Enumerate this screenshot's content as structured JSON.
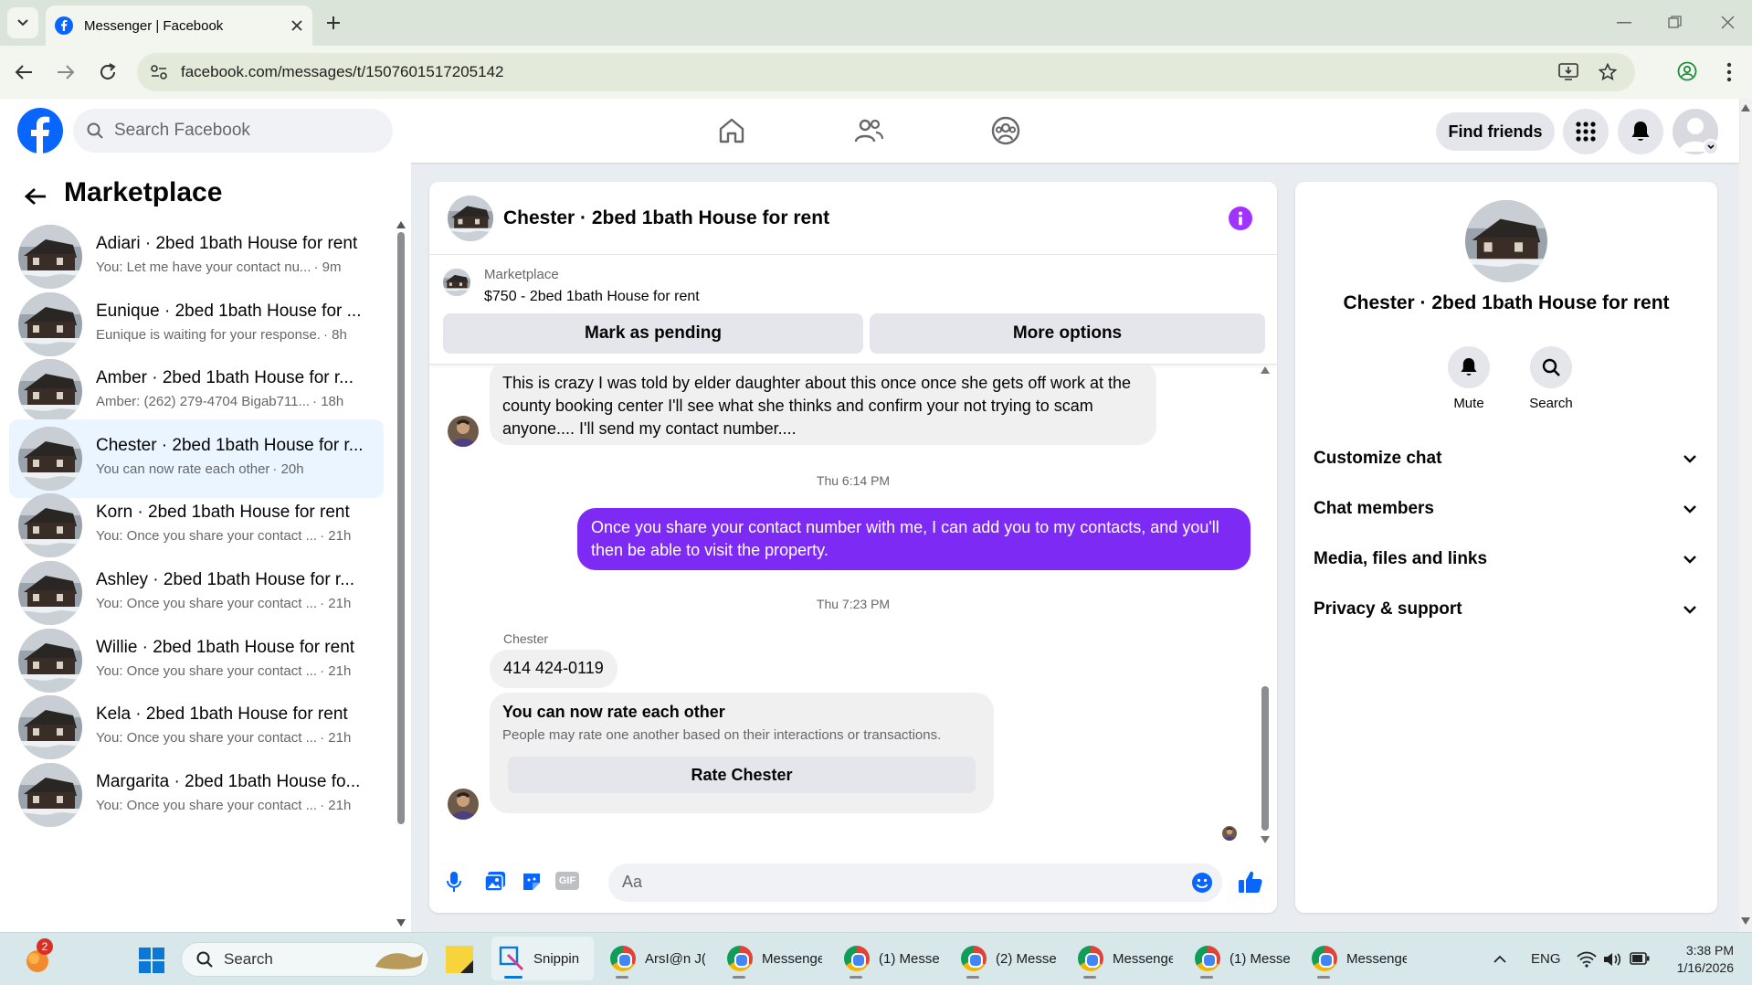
{
  "browser": {
    "tab_title": "Messenger | Facebook",
    "url": "facebook.com/messages/t/1507601517205142"
  },
  "header": {
    "search_placeholder": "Search Facebook",
    "find_friends": "Find friends"
  },
  "sidebar": {
    "title": "Marketplace",
    "conversations": [
      {
        "name": "Adiari · 2bed 1bath House for rent",
        "snippet": "You: Let me have your contact nu...",
        "time": "· 9m"
      },
      {
        "name": "Eunique · 2bed 1bath House for ...",
        "snippet": "Eunique is waiting for your response.",
        "time": "· 8h"
      },
      {
        "name": "Amber · 2bed 1bath House for r...",
        "snippet": "Amber: (262) 279-4704 Bigab711...",
        "time": "· 18h"
      },
      {
        "name": "Chester · 2bed 1bath House for r...",
        "snippet": "You can now rate each other",
        "time": "· 20h"
      },
      {
        "name": "Korn · 2bed 1bath House for rent",
        "snippet": "You: Once you share your contact ...",
        "time": "· 21h"
      },
      {
        "name": "Ashley · 2bed 1bath House for r...",
        "snippet": "You: Once you share your contact ...",
        "time": "· 21h"
      },
      {
        "name": "Willie · 2bed 1bath House for rent",
        "snippet": "You: Once you share your contact ...",
        "time": "· 21h"
      },
      {
        "name": "Kela · 2bed 1bath House for rent",
        "snippet": "You: Once you share your contact ...",
        "time": "· 21h"
      },
      {
        "name": "Margarita · 2bed 1bath House fo...",
        "snippet": "You: Once you share your contact ...",
        "time": "· 21h"
      }
    ]
  },
  "chat": {
    "title": "Chester · 2bed 1bath House for rent",
    "listing_source": "Marketplace",
    "listing_title": "$750 - 2bed 1bath House for rent",
    "mark_pending": "Mark as pending",
    "more_options": "More options",
    "msg1": "This is crazy I was told by elder daughter  about this once once she gets off work at the county booking center I'll see what she thinks and confirm your not trying to scam anyone.... I'll send my contact number....",
    "time1": "Thu 6:14 PM",
    "msg2": "Once you share your contact number with me, I can add you to my contacts, and you'll then be able to visit the property.",
    "time2": "Thu 7:23 PM",
    "sender": "Chester",
    "msg3": "414 424-0119",
    "rate_title": "You can now rate each other",
    "rate_sub": "People may rate one another based on their interactions or transactions.",
    "rate_button": "Rate Chester",
    "composer_placeholder": "Aa"
  },
  "details": {
    "title": "Chester · 2bed 1bath House for rent",
    "mute": "Mute",
    "search": "Search",
    "sections": [
      "Customize chat",
      "Chat members",
      "Media, files and links",
      "Privacy & support"
    ]
  },
  "taskbar": {
    "search": "Search",
    "apps": [
      "Snippin",
      "ArsI@n J(",
      "Messenge",
      "(1) Messe",
      "(2) Messe",
      "Messenge",
      "(1) Messe",
      "Messenge"
    ],
    "badge": "2",
    "lang": "ENG",
    "time": "3:38 PM",
    "date": "1/16/2026"
  },
  "colors": {
    "fb_blue": "#0866ff",
    "outgoing_bubble": "#7d2af5",
    "active_conversation": "#ebf5ff"
  }
}
